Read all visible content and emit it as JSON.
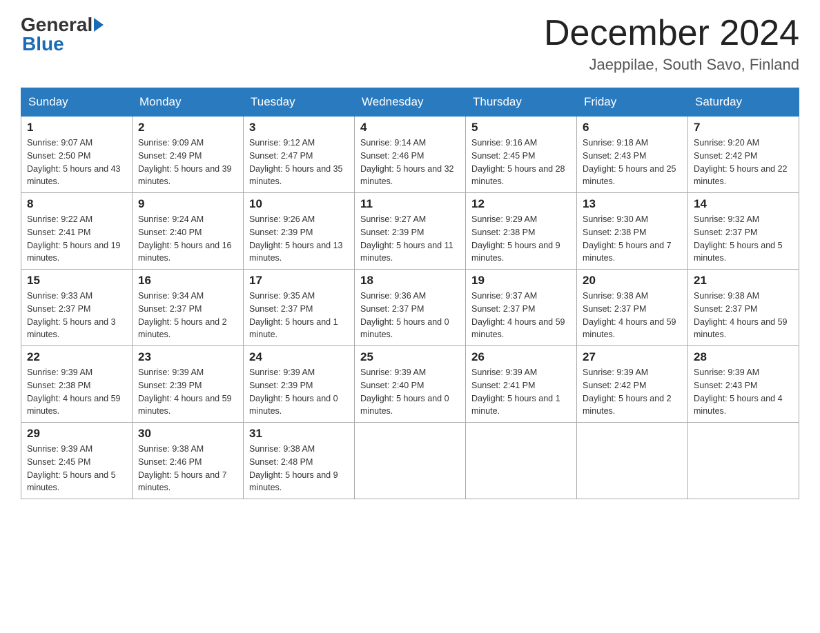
{
  "header": {
    "logo_general": "General",
    "logo_blue": "Blue",
    "month_title": "December 2024",
    "location": "Jaeppilae, South Savo, Finland"
  },
  "weekdays": [
    "Sunday",
    "Monday",
    "Tuesday",
    "Wednesday",
    "Thursday",
    "Friday",
    "Saturday"
  ],
  "weeks": [
    [
      {
        "day": "1",
        "sunrise": "9:07 AM",
        "sunset": "2:50 PM",
        "daylight": "5 hours and 43 minutes."
      },
      {
        "day": "2",
        "sunrise": "9:09 AM",
        "sunset": "2:49 PM",
        "daylight": "5 hours and 39 minutes."
      },
      {
        "day": "3",
        "sunrise": "9:12 AM",
        "sunset": "2:47 PM",
        "daylight": "5 hours and 35 minutes."
      },
      {
        "day": "4",
        "sunrise": "9:14 AM",
        "sunset": "2:46 PM",
        "daylight": "5 hours and 32 minutes."
      },
      {
        "day": "5",
        "sunrise": "9:16 AM",
        "sunset": "2:45 PM",
        "daylight": "5 hours and 28 minutes."
      },
      {
        "day": "6",
        "sunrise": "9:18 AM",
        "sunset": "2:43 PM",
        "daylight": "5 hours and 25 minutes."
      },
      {
        "day": "7",
        "sunrise": "9:20 AM",
        "sunset": "2:42 PM",
        "daylight": "5 hours and 22 minutes."
      }
    ],
    [
      {
        "day": "8",
        "sunrise": "9:22 AM",
        "sunset": "2:41 PM",
        "daylight": "5 hours and 19 minutes."
      },
      {
        "day": "9",
        "sunrise": "9:24 AM",
        "sunset": "2:40 PM",
        "daylight": "5 hours and 16 minutes."
      },
      {
        "day": "10",
        "sunrise": "9:26 AM",
        "sunset": "2:39 PM",
        "daylight": "5 hours and 13 minutes."
      },
      {
        "day": "11",
        "sunrise": "9:27 AM",
        "sunset": "2:39 PM",
        "daylight": "5 hours and 11 minutes."
      },
      {
        "day": "12",
        "sunrise": "9:29 AM",
        "sunset": "2:38 PM",
        "daylight": "5 hours and 9 minutes."
      },
      {
        "day": "13",
        "sunrise": "9:30 AM",
        "sunset": "2:38 PM",
        "daylight": "5 hours and 7 minutes."
      },
      {
        "day": "14",
        "sunrise": "9:32 AM",
        "sunset": "2:37 PM",
        "daylight": "5 hours and 5 minutes."
      }
    ],
    [
      {
        "day": "15",
        "sunrise": "9:33 AM",
        "sunset": "2:37 PM",
        "daylight": "5 hours and 3 minutes."
      },
      {
        "day": "16",
        "sunrise": "9:34 AM",
        "sunset": "2:37 PM",
        "daylight": "5 hours and 2 minutes."
      },
      {
        "day": "17",
        "sunrise": "9:35 AM",
        "sunset": "2:37 PM",
        "daylight": "5 hours and 1 minute."
      },
      {
        "day": "18",
        "sunrise": "9:36 AM",
        "sunset": "2:37 PM",
        "daylight": "5 hours and 0 minutes."
      },
      {
        "day": "19",
        "sunrise": "9:37 AM",
        "sunset": "2:37 PM",
        "daylight": "4 hours and 59 minutes."
      },
      {
        "day": "20",
        "sunrise": "9:38 AM",
        "sunset": "2:37 PM",
        "daylight": "4 hours and 59 minutes."
      },
      {
        "day": "21",
        "sunrise": "9:38 AM",
        "sunset": "2:37 PM",
        "daylight": "4 hours and 59 minutes."
      }
    ],
    [
      {
        "day": "22",
        "sunrise": "9:39 AM",
        "sunset": "2:38 PM",
        "daylight": "4 hours and 59 minutes."
      },
      {
        "day": "23",
        "sunrise": "9:39 AM",
        "sunset": "2:39 PM",
        "daylight": "4 hours and 59 minutes."
      },
      {
        "day": "24",
        "sunrise": "9:39 AM",
        "sunset": "2:39 PM",
        "daylight": "5 hours and 0 minutes."
      },
      {
        "day": "25",
        "sunrise": "9:39 AM",
        "sunset": "2:40 PM",
        "daylight": "5 hours and 0 minutes."
      },
      {
        "day": "26",
        "sunrise": "9:39 AM",
        "sunset": "2:41 PM",
        "daylight": "5 hours and 1 minute."
      },
      {
        "day": "27",
        "sunrise": "9:39 AM",
        "sunset": "2:42 PM",
        "daylight": "5 hours and 2 minutes."
      },
      {
        "day": "28",
        "sunrise": "9:39 AM",
        "sunset": "2:43 PM",
        "daylight": "5 hours and 4 minutes."
      }
    ],
    [
      {
        "day": "29",
        "sunrise": "9:39 AM",
        "sunset": "2:45 PM",
        "daylight": "5 hours and 5 minutes."
      },
      {
        "day": "30",
        "sunrise": "9:38 AM",
        "sunset": "2:46 PM",
        "daylight": "5 hours and 7 minutes."
      },
      {
        "day": "31",
        "sunrise": "9:38 AM",
        "sunset": "2:48 PM",
        "daylight": "5 hours and 9 minutes."
      },
      null,
      null,
      null,
      null
    ]
  ]
}
